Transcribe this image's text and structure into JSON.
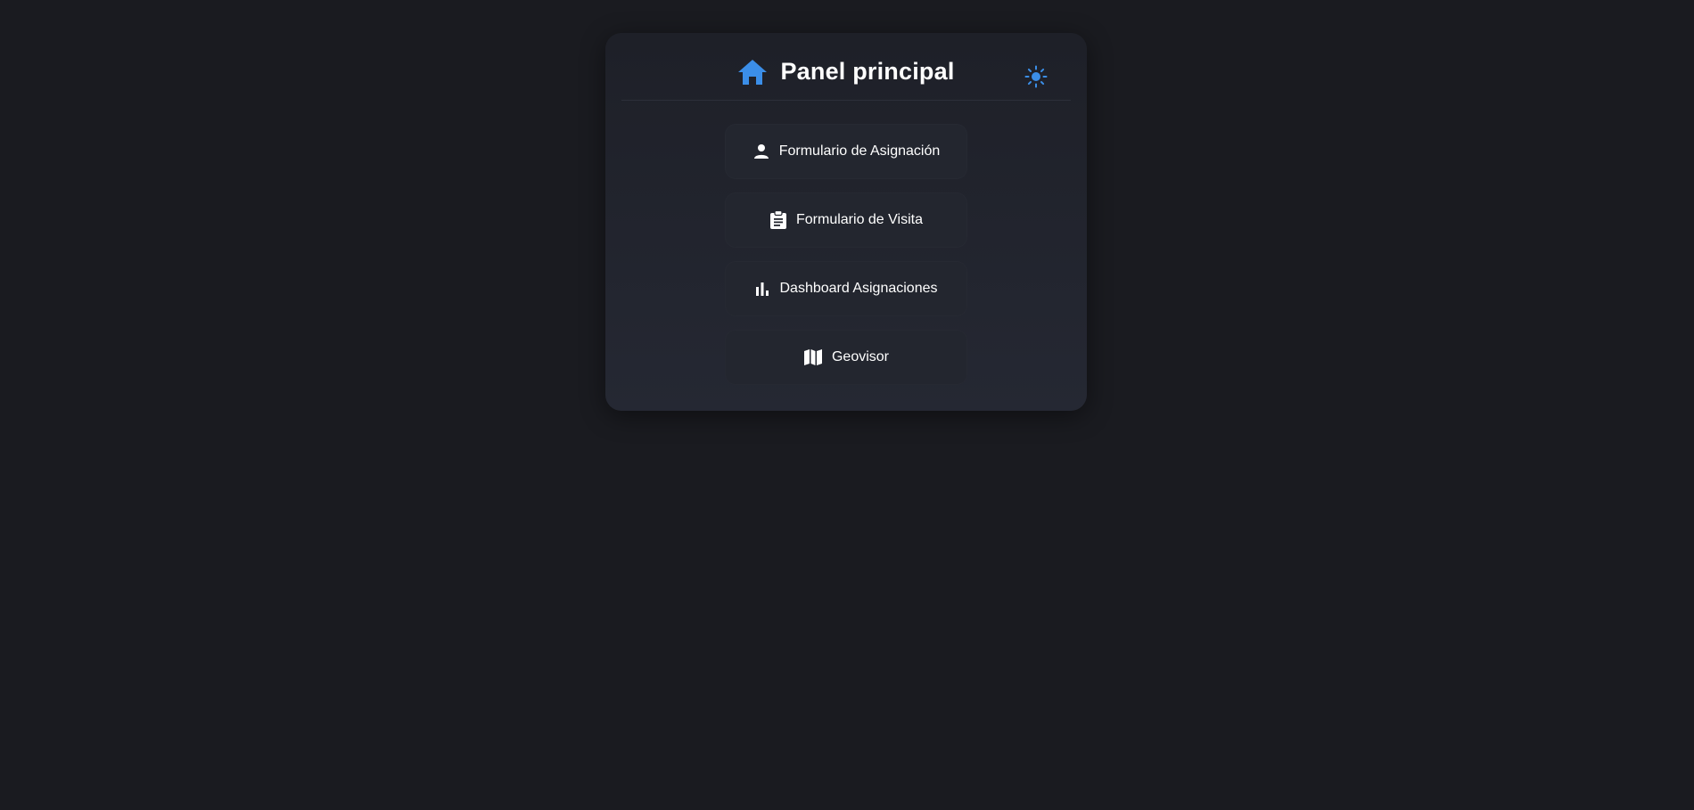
{
  "header": {
    "title": "Panel principal",
    "home_icon": "home-icon",
    "theme_icon": "sun-icon"
  },
  "menu": [
    {
      "label": "Formulario de Asignación",
      "icon": "person-icon"
    },
    {
      "label": "Formulario de Visita",
      "icon": "clipboard-icon"
    },
    {
      "label": "Dashboard Asignaciones",
      "icon": "bar-chart-icon"
    },
    {
      "label": "Geovisor",
      "icon": "map-icon"
    }
  ],
  "colors": {
    "background": "#1a1b20",
    "card": "#23262f",
    "accent": "#3b8ee8",
    "text": "#ffffff"
  }
}
